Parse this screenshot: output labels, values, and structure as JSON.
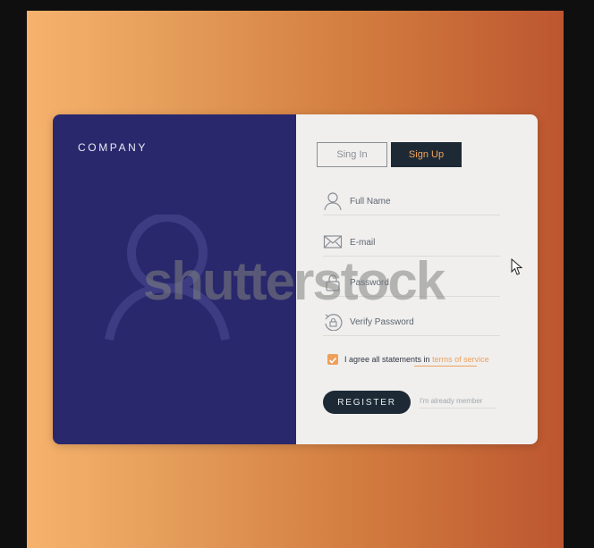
{
  "brand": {
    "company": "COMPANY"
  },
  "tabs": {
    "signin": "Sing In",
    "signup": "Sign Up"
  },
  "fields": [
    {
      "label": "Full Name",
      "icon": "user-icon"
    },
    {
      "label": "E-mail",
      "icon": "envelope-icon"
    },
    {
      "label": "Password",
      "icon": "lock-icon"
    },
    {
      "label": "Verify Password",
      "icon": "refresh-lock-icon"
    }
  ],
  "agree": {
    "checked": true,
    "text": "I agree all statements in",
    "link": "terms of service"
  },
  "register": {
    "label": "REGISTER"
  },
  "member_link": "I'm  already member",
  "watermark": "shutterstock",
  "colors": {
    "panel": "#29286c",
    "accent": "#eea05a",
    "dark_button": "#1d2a36",
    "form_bg": "#f0efee"
  }
}
